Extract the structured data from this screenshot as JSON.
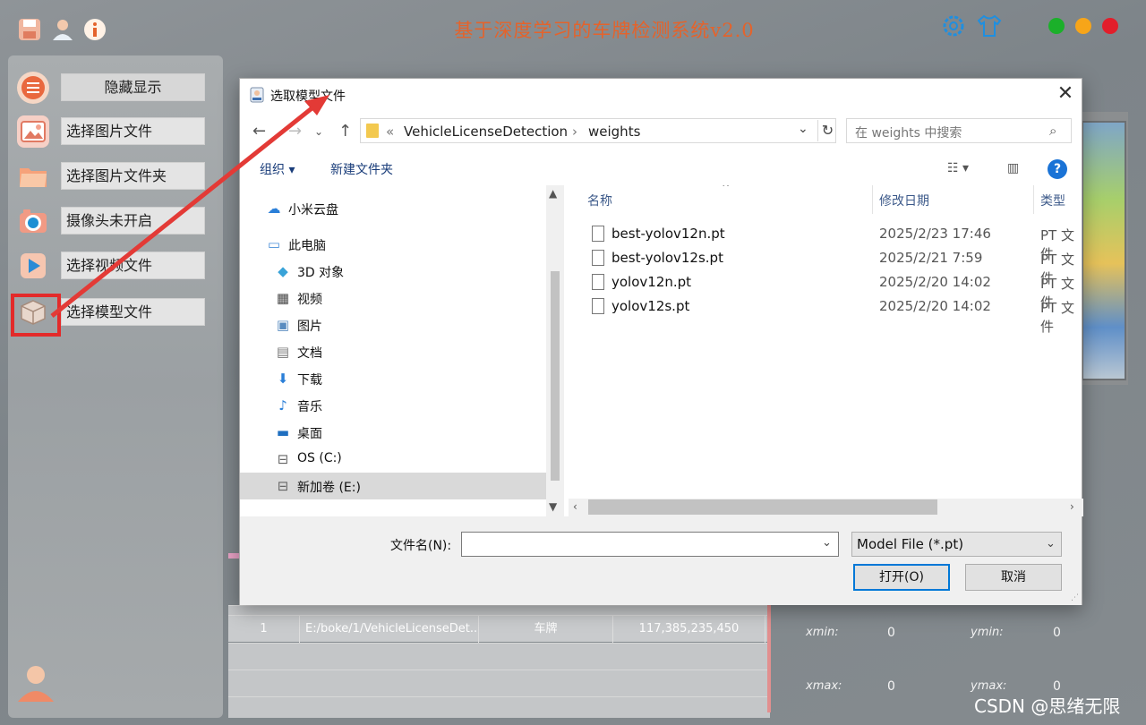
{
  "app": {
    "title": "基于深度学习的车牌检测系统v2.0",
    "accent": "#e4632b"
  },
  "sidebar": {
    "items": [
      {
        "label": "隐藏显示",
        "icon": "menu-icon"
      },
      {
        "label": "选择图片文件",
        "icon": "image-icon"
      },
      {
        "label": "选择图片文件夹",
        "icon": "folder-icon"
      },
      {
        "label": "摄像头未开启",
        "icon": "camera-icon"
      },
      {
        "label": "选择视频文件",
        "icon": "video-play-icon"
      },
      {
        "label": "选择模型文件",
        "icon": "model-box-icon"
      }
    ]
  },
  "background_table": {
    "row": {
      "index": "1",
      "path": "E:/boke/1/VehicleLicenseDet...",
      "class": "车牌",
      "coords": "117,385,235,450"
    }
  },
  "coords_panel": {
    "xmin_label": "xmin:",
    "xmin": "0",
    "ymin_label": "ymin:",
    "ymin": "0",
    "xmax_label": "xmax:",
    "xmax": "0",
    "ymax_label": "ymax:",
    "ymax": "0"
  },
  "dialog": {
    "title": "选取模型文件",
    "breadcrumb": {
      "prefix": "«",
      "parent": "VehicleLicenseDetection",
      "sep": "›",
      "current": "weights"
    },
    "search_placeholder": "在 weights 中搜索",
    "toolbar": {
      "organize": "组织 ▾",
      "new_folder": "新建文件夹"
    },
    "nav": [
      {
        "label": "小米云盘",
        "icon": "cloud-icon"
      },
      {
        "label": "此电脑",
        "icon": "computer-icon"
      },
      {
        "label": "3D 对象",
        "icon": "cube-3d-icon"
      },
      {
        "label": "视频",
        "icon": "video-icon"
      },
      {
        "label": "图片",
        "icon": "picture-icon"
      },
      {
        "label": "文档",
        "icon": "document-icon"
      },
      {
        "label": "下载",
        "icon": "download-icon"
      },
      {
        "label": "音乐",
        "icon": "music-icon"
      },
      {
        "label": "桌面",
        "icon": "desktop-icon"
      },
      {
        "label": "OS (C:)",
        "icon": "drive-c-icon"
      },
      {
        "label": "新加卷 (E:)",
        "icon": "drive-e-icon"
      }
    ],
    "columns": {
      "name": "名称",
      "date": "修改日期",
      "type": "类型"
    },
    "files": [
      {
        "name": "best-yolov12n.pt",
        "date": "2025/2/23 17:46",
        "type": "PT 文件"
      },
      {
        "name": "best-yolov12s.pt",
        "date": "2025/2/21 7:59",
        "type": "PT 文件"
      },
      {
        "name": "yolov12n.pt",
        "date": "2025/2/20 14:02",
        "type": "PT 文件"
      },
      {
        "name": "yolov12s.pt",
        "date": "2025/2/20 14:02",
        "type": "PT 文件"
      }
    ],
    "filename_label": "文件名(N):",
    "filename_value": "",
    "filter": "Model File (*.pt)",
    "open_button": "打开(O)",
    "cancel_button": "取消"
  },
  "watermark": "CSDN @思绪无限",
  "colors": {
    "highlight": "#e32a2a",
    "link": "#1a3d7a",
    "help": "#1a73d6"
  }
}
